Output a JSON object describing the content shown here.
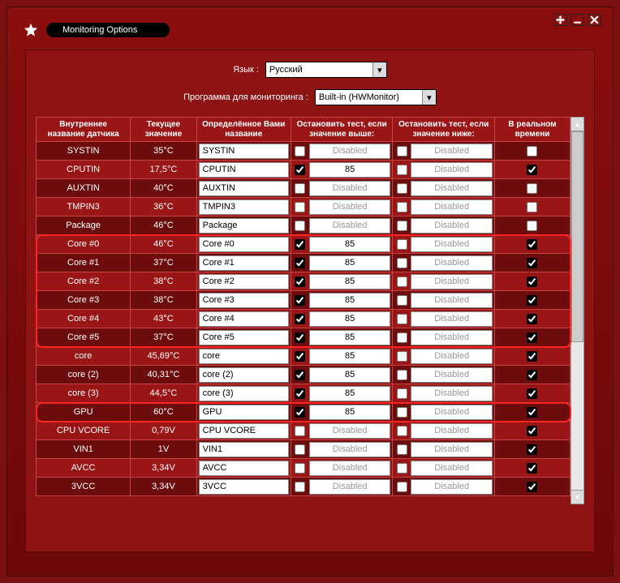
{
  "window_title": "Monitoring Options",
  "language": {
    "label": "Язык :",
    "value": "Русский"
  },
  "program": {
    "label": "Программа для мониторинга :",
    "value": "Built-in (HWMonitor)"
  },
  "headers": {
    "internal_name": "Внутреннее название датчика",
    "current_value": "Текущее значение",
    "custom_name": "Определённое Вами название",
    "stop_above": "Остановить тест, если значение выше:",
    "stop_below": "Остановить тест, если значение ниже:",
    "realtime": "В реальном времени"
  },
  "disabled_text": "Disabled",
  "rows": [
    {
      "name": "SYSTIN",
      "value": "35°C",
      "custom": "SYSTIN",
      "sa_chk": false,
      "sa_val": "Disabled",
      "sb_chk": false,
      "sb_val": "Disabled",
      "rt": false,
      "shade": "dark"
    },
    {
      "name": "CPUTIN",
      "value": "17,5°C",
      "custom": "CPUTIN",
      "sa_chk": true,
      "sa_val": "85",
      "sb_chk": false,
      "sb_val": "Disabled",
      "rt": true,
      "shade": "light"
    },
    {
      "name": "AUXTIN",
      "value": "40°C",
      "custom": "AUXTIN",
      "sa_chk": false,
      "sa_val": "Disabled",
      "sb_chk": false,
      "sb_val": "Disabled",
      "rt": false,
      "shade": "dark"
    },
    {
      "name": "TMPIN3",
      "value": "36°C",
      "custom": "TMPIN3",
      "sa_chk": false,
      "sa_val": "Disabled",
      "sb_chk": false,
      "sb_val": "Disabled",
      "rt": false,
      "shade": "light"
    },
    {
      "name": "Package",
      "value": "46°C",
      "custom": "Package",
      "sa_chk": false,
      "sa_val": "Disabled",
      "sb_chk": false,
      "sb_val": "Disabled",
      "rt": false,
      "shade": "dark"
    },
    {
      "name": "Core #0",
      "value": "46°C",
      "custom": "Core #0",
      "sa_chk": true,
      "sa_val": "85",
      "sb_chk": false,
      "sb_val": "Disabled",
      "rt": true,
      "shade": "light"
    },
    {
      "name": "Core #1",
      "value": "37°C",
      "custom": "Core #1",
      "sa_chk": true,
      "sa_val": "85",
      "sb_chk": false,
      "sb_val": "Disabled",
      "rt": true,
      "shade": "dark"
    },
    {
      "name": "Core #2",
      "value": "38°C",
      "custom": "Core #2",
      "sa_chk": true,
      "sa_val": "85",
      "sb_chk": false,
      "sb_val": "Disabled",
      "rt": true,
      "shade": "light"
    },
    {
      "name": "Core #3",
      "value": "38°C",
      "custom": "Core #3",
      "sa_chk": true,
      "sa_val": "85",
      "sb_chk": false,
      "sb_val": "Disabled",
      "rt": true,
      "shade": "dark"
    },
    {
      "name": "Core #4",
      "value": "43°C",
      "custom": "Core #4",
      "sa_chk": true,
      "sa_val": "85",
      "sb_chk": false,
      "sb_val": "Disabled",
      "rt": true,
      "shade": "light"
    },
    {
      "name": "Core #5",
      "value": "37°C",
      "custom": "Core #5",
      "sa_chk": true,
      "sa_val": "85",
      "sb_chk": false,
      "sb_val": "Disabled",
      "rt": true,
      "shade": "dark"
    },
    {
      "name": "core",
      "value": "45,69°C",
      "custom": "core",
      "sa_chk": true,
      "sa_val": "85",
      "sb_chk": false,
      "sb_val": "Disabled",
      "rt": true,
      "shade": "light"
    },
    {
      "name": "core (2)",
      "value": "40,31°C",
      "custom": "core (2)",
      "sa_chk": true,
      "sa_val": "85",
      "sb_chk": false,
      "sb_val": "Disabled",
      "rt": true,
      "shade": "dark"
    },
    {
      "name": "core (3)",
      "value": "44,5°C",
      "custom": "core (3)",
      "sa_chk": true,
      "sa_val": "85",
      "sb_chk": false,
      "sb_val": "Disabled",
      "rt": true,
      "shade": "light"
    },
    {
      "name": "GPU",
      "value": "60°C",
      "custom": "GPU",
      "sa_chk": true,
      "sa_val": "85",
      "sb_chk": false,
      "sb_val": "Disabled",
      "rt": true,
      "shade": "dark"
    },
    {
      "name": "CPU VCORE",
      "value": "0,79V",
      "custom": "CPU VCORE",
      "sa_chk": false,
      "sa_val": "Disabled",
      "sb_chk": false,
      "sb_val": "Disabled",
      "rt": true,
      "shade": "light"
    },
    {
      "name": "VIN1",
      "value": "1V",
      "custom": "VIN1",
      "sa_chk": false,
      "sa_val": "Disabled",
      "sb_chk": false,
      "sb_val": "Disabled",
      "rt": true,
      "shade": "dark"
    },
    {
      "name": "AVCC",
      "value": "3,34V",
      "custom": "AVCC",
      "sa_chk": false,
      "sa_val": "Disabled",
      "sb_chk": false,
      "sb_val": "Disabled",
      "rt": true,
      "shade": "light"
    },
    {
      "name": "3VCC",
      "value": "3,34V",
      "custom": "3VCC",
      "sa_chk": false,
      "sa_val": "Disabled",
      "sb_chk": false,
      "sb_val": "Disabled",
      "rt": true,
      "shade": "dark"
    }
  ],
  "highlights": [
    {
      "start": 5,
      "end": 10
    },
    {
      "start": 14,
      "end": 14
    }
  ]
}
